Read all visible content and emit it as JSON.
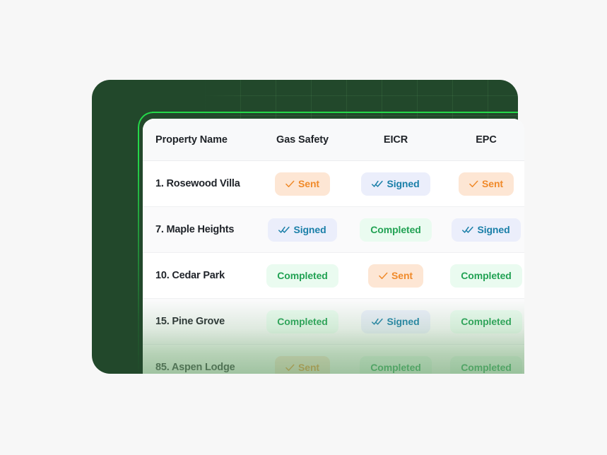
{
  "theme": {
    "page_background": "#F7F7F7",
    "card_green": "#22482B",
    "accent_green": "#25D94A",
    "sent_bg": "#FDE6D4",
    "sent_fg": "#F08A2A",
    "signed_bg": "#EBEEFB",
    "signed_fg": "#1A7FA8",
    "completed_bg": "#EAFBF0",
    "completed_fg": "#22A254"
  },
  "table": {
    "columns": [
      {
        "key": "property_name",
        "label": "Property Name"
      },
      {
        "key": "gas_safety",
        "label": "Gas Safety"
      },
      {
        "key": "eicr",
        "label": "EICR"
      },
      {
        "key": "epc",
        "label": "EPC"
      }
    ],
    "rows": [
      {
        "property_name": "1. Rosewood Villa",
        "gas_safety": {
          "label": "Sent",
          "state": "sent",
          "icon": "check-icon"
        },
        "eicr": {
          "label": "Signed",
          "state": "signed",
          "icon": "double-check-icon"
        },
        "epc": {
          "label": "Sent",
          "state": "sent",
          "icon": "check-icon"
        }
      },
      {
        "property_name": "7. Maple Heights",
        "gas_safety": {
          "label": "Signed",
          "state": "signed",
          "icon": "double-check-icon"
        },
        "eicr": {
          "label": "Completed",
          "state": "completed",
          "icon": "none"
        },
        "epc": {
          "label": "Signed",
          "state": "signed",
          "icon": "double-check-icon"
        }
      },
      {
        "property_name": "10. Cedar Park",
        "gas_safety": {
          "label": "Completed",
          "state": "completed",
          "icon": "none"
        },
        "eicr": {
          "label": "Sent",
          "state": "sent",
          "icon": "check-icon"
        },
        "epc": {
          "label": "Completed",
          "state": "completed",
          "icon": "none"
        }
      },
      {
        "property_name": "15. Pine Grove",
        "gas_safety": {
          "label": "Completed",
          "state": "completed",
          "icon": "none"
        },
        "eicr": {
          "label": "Signed",
          "state": "signed",
          "icon": "double-check-icon"
        },
        "epc": {
          "label": "Completed",
          "state": "completed",
          "icon": "none"
        }
      },
      {
        "property_name": "85. Aspen Lodge",
        "gas_safety": {
          "label": "Sent",
          "state": "sent",
          "icon": "check-icon"
        },
        "eicr": {
          "label": "Completed",
          "state": "completed",
          "icon": "none"
        },
        "epc": {
          "label": "Completed",
          "state": "completed",
          "icon": "none"
        }
      }
    ]
  }
}
